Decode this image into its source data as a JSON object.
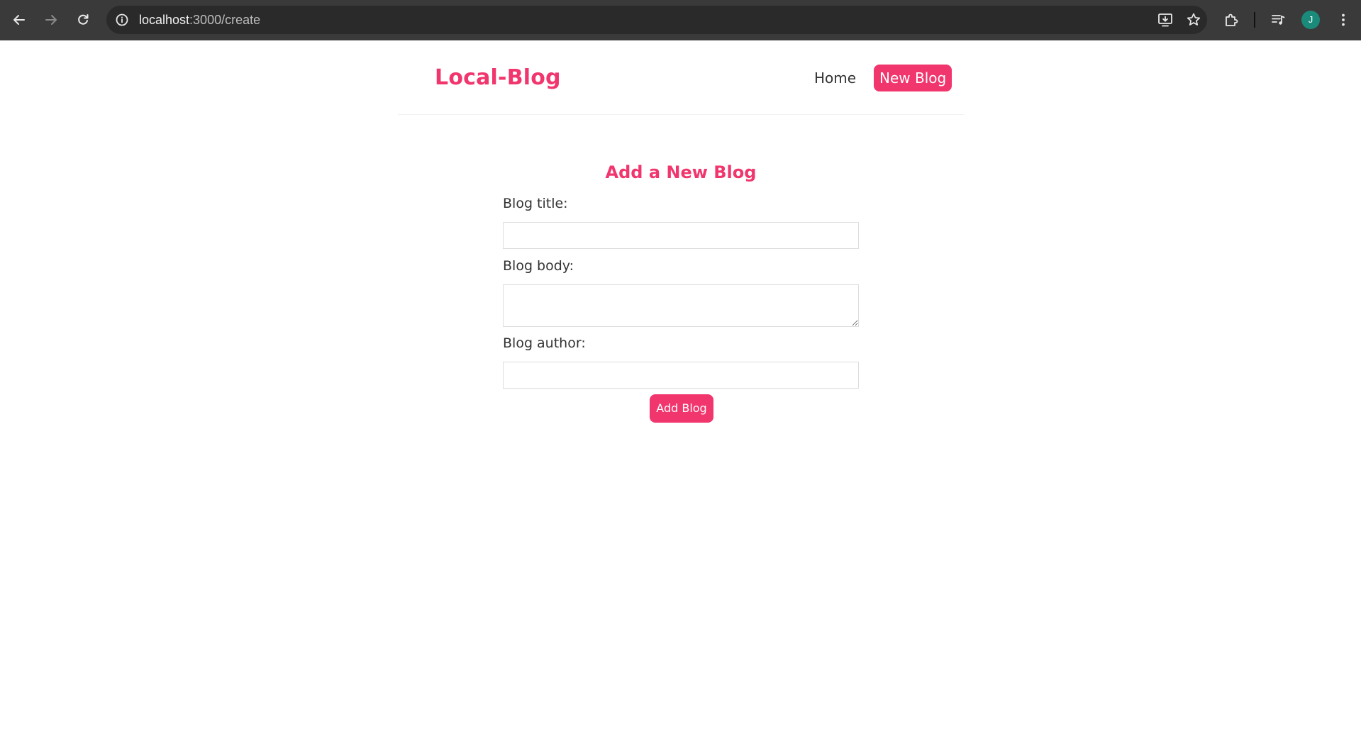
{
  "browser": {
    "url_host": "localhost",
    "url_path": ":3000/create",
    "profile_initial": "J"
  },
  "site": {
    "logo": "Local-Blog",
    "nav": {
      "home_label": "Home",
      "new_blog_label": "New Blog"
    }
  },
  "form": {
    "heading": "Add a New Blog",
    "title_label": "Blog title:",
    "title_value": "",
    "body_label": "Blog body:",
    "body_value": "",
    "author_label": "Blog author:",
    "author_value": "",
    "submit_label": "Add Blog"
  },
  "colors": {
    "brand": "#f1356d",
    "text": "#333333",
    "chrome_bg": "#3a3a3a",
    "omnibox_bg": "#2a2a2a",
    "avatar_bg": "#1a8a7a"
  }
}
